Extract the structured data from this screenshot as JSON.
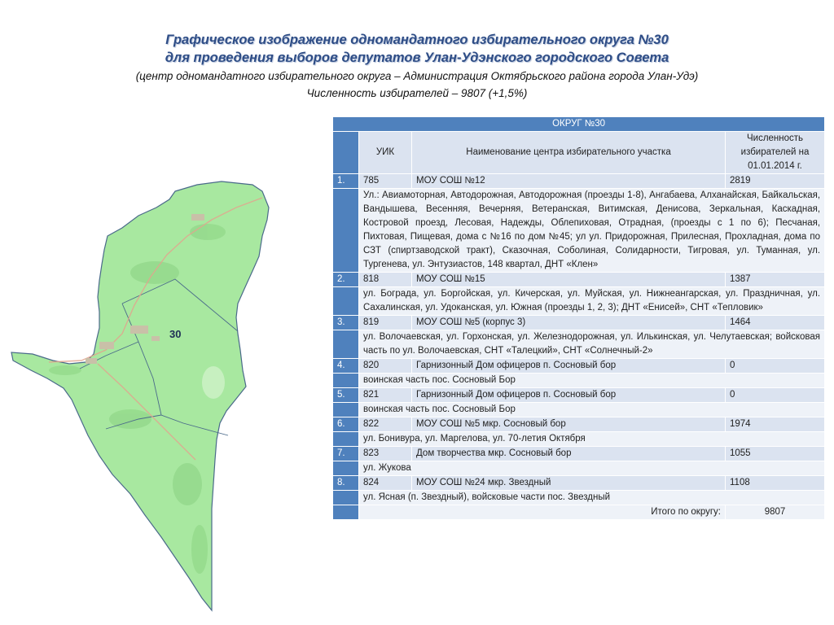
{
  "header": {
    "title_line1": "Графическое изображение одномандатного избирательного округа №30",
    "title_line2": "для проведения выборов депутатов Улан-Удэнского городского Совета",
    "subtitle": "(центр одномандатного избирательного округа – Администрация Октябрьского района города Улан-Удэ)",
    "voters_line": "Численность избирателей – 9807 (+1,5%)"
  },
  "map": {
    "district_label": "30",
    "fill_color": "#a8e8a0",
    "border_color": "#4a6a8a"
  },
  "table": {
    "title": "ОКРУГ №30",
    "col_uik": "УИК",
    "col_name": "Наименование центра избирательного участка",
    "col_voters": "Численность избирателей на 01.01.2014 г.",
    "rows": [
      {
        "num": "1.",
        "uik": "785",
        "name": "МОУ СОШ №12",
        "voters": "2819",
        "streets": "Ул.: Авиамоторная, Автодорожная, Автодорожная (проезды 1-8), Ангабаева, Алханайская, Байкальская, Вандышева, Весенняя, Вечерняя, Ветеранская, Витимская, Денисова, Зеркальная, Каскадная, Костровой проезд, Лесовая, Надежды, Облепиховая, Отрадная, (проезды с 1 по 6); Песчаная, Пихтовая, Пищевая, дома с №16 по дом №45; ул ул. Придорожная, Прилесная, Прохладная, дома по СЗТ (спиртзаводской тракт), Сказочная, Соболиная, Солидарности, Тигровая, ул. Туманная, ул. Тургенева, ул. Энтузиастов, 148 квартал, ДНТ «Клен»"
      },
      {
        "num": "2.",
        "uik": "818",
        "name": "МОУ СОШ №15",
        "voters": "1387",
        "streets": "ул. Бограда, ул. Боргойская, ул. Кичерская, ул. Муйская, ул. Нижнеангарская, ул. Праздничная, ул. Сахалинская, ул. Удоканская, ул. Южная (проезды 1, 2, 3); ДНТ «Енисей», СНТ «Тепловик»"
      },
      {
        "num": "3.",
        "uik": "819",
        "name": "МОУ СОШ №5 (корпус 3)",
        "voters": "1464",
        "streets": "ул. Волочаевская, ул. Горхонская, ул. Железнодорожная, ул. Илькинская, ул. Челутаевская; войсковая часть по ул. Волочаевская, СНТ «Талецкий», СНТ «Солнечный-2»"
      },
      {
        "num": "4.",
        "uik": "820",
        "name": "Гарнизонный Дом офицеров п. Сосновый бор",
        "voters": "0",
        "streets": "воинская часть пос. Сосновый Бор"
      },
      {
        "num": "5.",
        "uik": "821",
        "name": "Гарнизонный Дом офицеров п. Сосновый бор",
        "voters": "0",
        "streets": "воинская часть пос. Сосновый Бор"
      },
      {
        "num": "6.",
        "uik": "822",
        "name": "МОУ СОШ №5 мкр. Сосновый бор",
        "voters": "1974",
        "streets": "ул. Бонивура, ул. Маргелова, ул. 70-летия Октября"
      },
      {
        "num": "7.",
        "uik": "823",
        "name": "Дом творчества мкр. Сосновый бор",
        "voters": "1055",
        "streets": "ул. Жукова"
      },
      {
        "num": "8.",
        "uik": "824",
        "name": "МОУ СОШ №24 мкр. Звездный",
        "voters": "1108",
        "streets": "ул. Ясная (п. Звездный), войсковые части пос. Звездный"
      }
    ],
    "total_label": "Итого по округу:",
    "total_value": "9807"
  }
}
